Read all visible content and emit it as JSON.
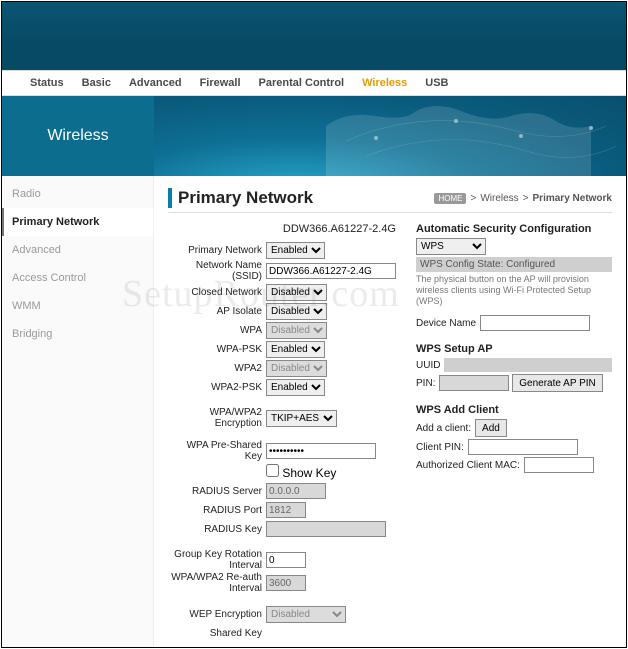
{
  "nav": {
    "items": [
      "Status",
      "Basic",
      "Advanced",
      "Firewall",
      "Parental Control",
      "Wireless",
      "USB"
    ],
    "active": "Wireless"
  },
  "hero_title": "Wireless",
  "sidebar": {
    "items": [
      "Radio",
      "Primary Network",
      "Advanced",
      "Access Control",
      "WMM",
      "Bridging"
    ],
    "active": "Primary Network"
  },
  "page_title": "Primary Network",
  "breadcrumb": {
    "home": "HOME",
    "sep1": ">",
    "a": "Wireless",
    "sep2": ">",
    "b": "Primary Network"
  },
  "left": {
    "device_heading": "DDW366.A61227-2.4G",
    "primary_network_label": "Primary Network",
    "primary_network_value": "Enabled",
    "ssid_label": "Network Name (SSID)",
    "ssid_value": "DDW366.A61227-2.4G",
    "closed_label": "Closed Network",
    "closed_value": "Disabled",
    "apiso_label": "AP Isolate",
    "apiso_value": "Disabled",
    "wpa_label": "WPA",
    "wpa_value": "Disabled",
    "wpapsk_label": "WPA-PSK",
    "wpapsk_value": "Enabled",
    "wpa2_label": "WPA2",
    "wpa2_value": "Disabled",
    "wpa2psk_label": "WPA2-PSK",
    "wpa2psk_value": "Enabled",
    "enc_label": "WPA/WPA2 Encryption",
    "enc_value": "TKIP+AES",
    "psk_label": "WPA Pre-Shared Key",
    "psk_value": "••••••••••",
    "showkey_label": " Show Key",
    "radius_server_label": "RADIUS Server",
    "radius_server_value": "0.0.0.0",
    "radius_port_label": "RADIUS Port",
    "radius_port_value": "1812",
    "radius_key_label": "RADIUS Key",
    "radius_key_value": "",
    "grk_label": "Group Key Rotation Interval",
    "grk_value": "0",
    "reauth_label": "WPA/WPA2 Re-auth Interval",
    "reauth_value": "3600",
    "wep_label": "WEP Encryption",
    "wep_value": "Disabled",
    "sharedkey_label": "Shared Key"
  },
  "right": {
    "asc_heading": "Automatic Security Configuration",
    "asc_mode": "WPS",
    "asc_status": "WPS Config State: Configured",
    "asc_helper": "The physical button on the AP will provision wireless clients using Wi-Fi Protected Setup (WPS)",
    "devname_label": "Device Name",
    "devname_value": "",
    "setup_heading": "WPS Setup AP",
    "uuid_label": "UUID",
    "pin_label": "PIN:",
    "pin_value": "",
    "genpin_btn": "Generate AP PIN",
    "addclient_heading": "WPS Add Client",
    "addclient_label": "Add a client:",
    "add_btn": "Add",
    "clientpin_label": "Client PIN:",
    "clientpin_value": "",
    "authmac_label": "Authorized Client MAC:",
    "authmac_value": ""
  },
  "watermark": "SetupRouter.com"
}
